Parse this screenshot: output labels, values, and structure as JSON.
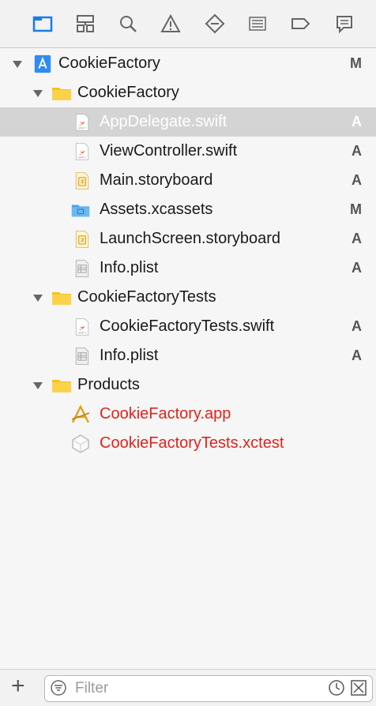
{
  "navigator_tabs": [
    {
      "name": "project-navigator-icon",
      "active": true
    },
    {
      "name": "symbol-navigator-icon",
      "active": false
    },
    {
      "name": "find-navigator-icon",
      "active": false
    },
    {
      "name": "issue-navigator-icon",
      "active": false
    },
    {
      "name": "test-navigator-icon",
      "active": false
    },
    {
      "name": "debug-navigator-icon",
      "active": false
    },
    {
      "name": "breakpoint-navigator-icon",
      "active": false
    },
    {
      "name": "report-navigator-icon",
      "active": false
    }
  ],
  "tree": {
    "project": {
      "label": "CookieFactory",
      "status": "M"
    },
    "group_main": {
      "label": "CookieFactory"
    },
    "files_main": [
      {
        "label": "AppDelegate.swift",
        "status": "A"
      },
      {
        "label": "ViewController.swift",
        "status": "A"
      },
      {
        "label": "Main.storyboard",
        "status": "A"
      },
      {
        "label": "Assets.xcassets",
        "status": "M"
      },
      {
        "label": "LaunchScreen.storyboard",
        "status": "A"
      },
      {
        "label": "Info.plist",
        "status": "A"
      }
    ],
    "group_tests": {
      "label": "CookieFactoryTests"
    },
    "files_tests": [
      {
        "label": "CookieFactoryTests.swift",
        "status": "A"
      },
      {
        "label": "Info.plist",
        "status": "A"
      }
    ],
    "group_products": {
      "label": "Products"
    },
    "files_products": [
      {
        "label": "CookieFactory.app"
      },
      {
        "label": "CookieFactoryTests.xctest"
      }
    ]
  },
  "footer": {
    "add_label": "+",
    "filter_placeholder": "Filter"
  },
  "colors": {
    "accent": "#1a7ce5",
    "missing": "#e0231b",
    "folder": "#f5c31a"
  }
}
